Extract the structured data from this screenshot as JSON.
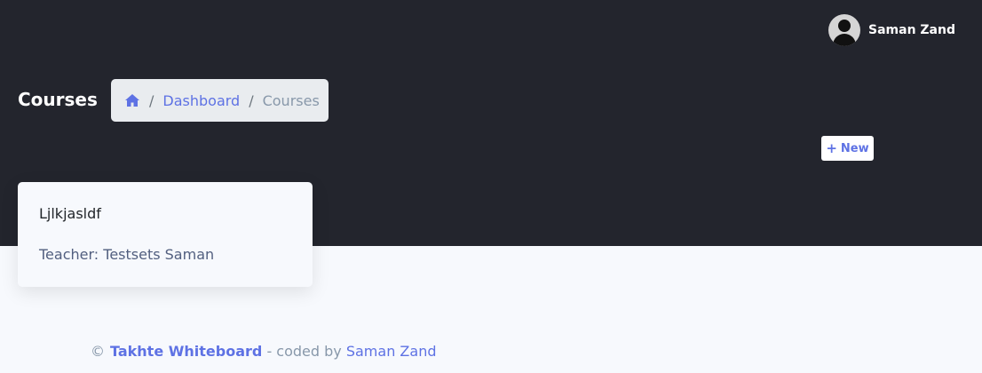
{
  "colors": {
    "header_bg": "#23252d",
    "page_bg": "#f7f9fd",
    "accent": "#5e72e4",
    "breadcrumb_bg": "#e9ecef"
  },
  "user": {
    "name": "Saman Zand",
    "avatar_icon": "user-avatar-icon"
  },
  "page": {
    "title": "Courses"
  },
  "breadcrumb": {
    "home_icon": "home-icon",
    "separator": "/",
    "items": [
      {
        "label": "Dashboard",
        "active": false
      },
      {
        "label": "Courses",
        "active": true
      }
    ]
  },
  "actions": {
    "new_label": "New",
    "new_icon": "plus-icon"
  },
  "courses": [
    {
      "title": "Ljlkjasldf",
      "teacher": "Teacher: Testsets Saman"
    }
  ],
  "footer": {
    "copyright": "©",
    "brand": "Takhte Whiteboard",
    "coded_by": " - coded by ",
    "author": "Saman Zand"
  }
}
